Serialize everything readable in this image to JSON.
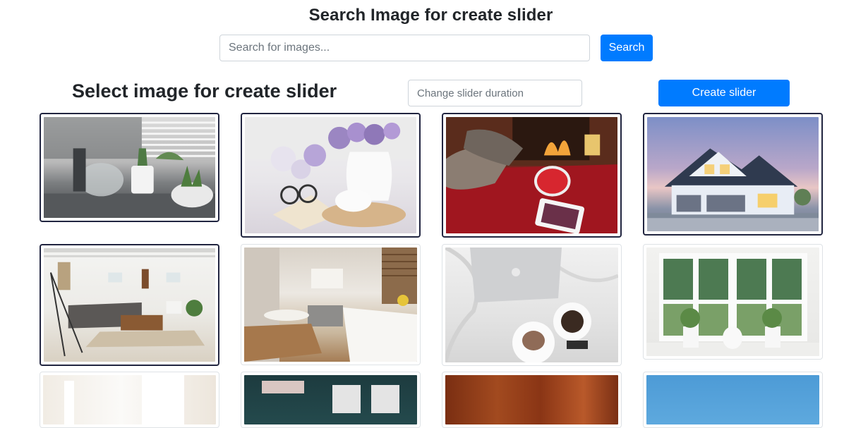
{
  "header": {
    "title": "Search Image for create slider",
    "search_placeholder": "Search for images...",
    "search_value": "",
    "search_button": "Search"
  },
  "slider_panel": {
    "title": "Select image for create slider",
    "duration_placeholder": "Change slider duration",
    "duration_value": "",
    "create_button": "Create slider"
  },
  "colors": {
    "primary": "#007bff",
    "selected_border": "#212540",
    "thumb_border": "#dee2e6"
  },
  "images": [
    {
      "subject": "plants-on-windowsill",
      "selected": true
    },
    {
      "subject": "lilac-book-teacup",
      "selected": true
    },
    {
      "subject": "cozy-fireplace-slippers",
      "selected": true
    },
    {
      "subject": "suburban-house-dusk",
      "selected": true
    },
    {
      "subject": "bright-living-room",
      "selected": true
    },
    {
      "subject": "white-kitchen",
      "selected": false
    },
    {
      "subject": "laptop-coffee-bed",
      "selected": false
    },
    {
      "subject": "window-flower-pots",
      "selected": false
    },
    {
      "subject": "white-curtains",
      "selected": false
    },
    {
      "subject": "building-facade",
      "selected": false
    },
    {
      "subject": "wood-texture",
      "selected": false
    },
    {
      "subject": "blue-sky",
      "selected": false
    }
  ]
}
